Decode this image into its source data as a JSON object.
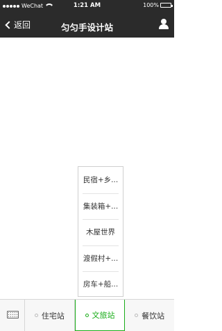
{
  "status_bar": {
    "carrier": "WeChat",
    "time": "1:21 AM",
    "battery": "100%",
    "signal_bars_filled": 5,
    "icons": [
      "signal-dots-icon",
      "wifi-icon",
      "battery-icon"
    ]
  },
  "nav": {
    "back_label": "返回",
    "title": "匀匀手设计站",
    "icons": [
      "chevron-left-icon",
      "user-icon"
    ]
  },
  "popup_menu": {
    "items": [
      "民宿+乡...",
      "集装箱+...",
      "木屋世界",
      "渡假村+...",
      "房车+船..."
    ]
  },
  "tab_bar": {
    "keyboard_icon": "keyboard-icon",
    "tabs": [
      {
        "label": "住宅站",
        "active": false
      },
      {
        "label": "文旅站",
        "active": true
      },
      {
        "label": "餐饮站",
        "active": false
      }
    ],
    "accent_color": "#1aad19"
  }
}
